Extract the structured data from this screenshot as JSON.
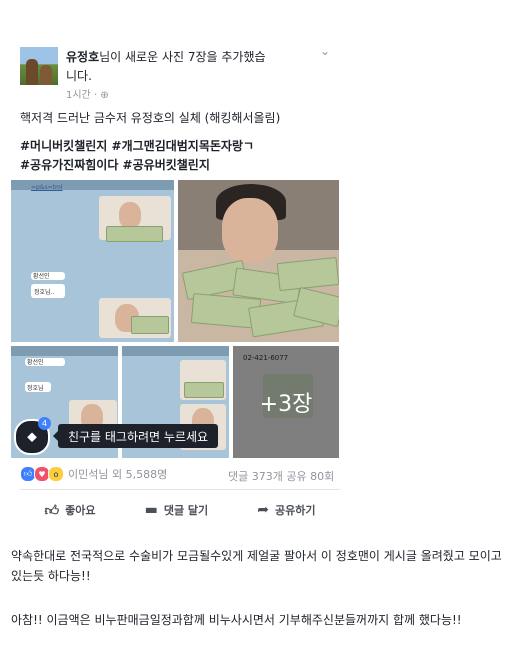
{
  "post": {
    "author": "유정호",
    "action": "님이 새로운 사진 7장을 추가했습니다.",
    "time": "1시간",
    "privacy_icon": "globe-icon",
    "caption": "핵저격 드러난 금수저 유정호의 실체 (해킹해서올림)",
    "hashtags": [
      "#머니버킷챌린지 #개그맨김대범지목돈자랑ㄱ",
      "#공유가진짜힘이다 #공유버킷챌린지"
    ]
  },
  "photos": {
    "chat_link": "=p&s=tml",
    "phone_number": "02-421-6077",
    "more_label": "+3장",
    "tag_count": "4",
    "tag_tooltip": "친구를 태그하려면 누르세요",
    "chat_names": [
      "황선인",
      "정호님..",
      "황선인",
      "정호님"
    ]
  },
  "engagement": {
    "reactions_text": "이민석님 외 5,588명",
    "counts_text": "댓글 373개 공유 80회",
    "reaction_icons": [
      "like-icon",
      "love-icon",
      "wow-icon"
    ]
  },
  "actions": {
    "like": "좋아요",
    "comment": "댓글 달기",
    "share": "공유하기"
  },
  "body": {
    "para1": "약속한대로 전국적으로 수술비가 모금될수있게 제얼굴 팔아서 이 정호맨이 게시글 올려줬고 모이고 있는듯 하다능!!",
    "para2": "아참!! 이금액은 비누판매금일정과합께 비누사시면서 기부해주신분들꺼까지 합께 했다능!!"
  },
  "colors": {
    "accent": "#4080ff",
    "link": "#3b5998",
    "meta": "#90949c"
  }
}
